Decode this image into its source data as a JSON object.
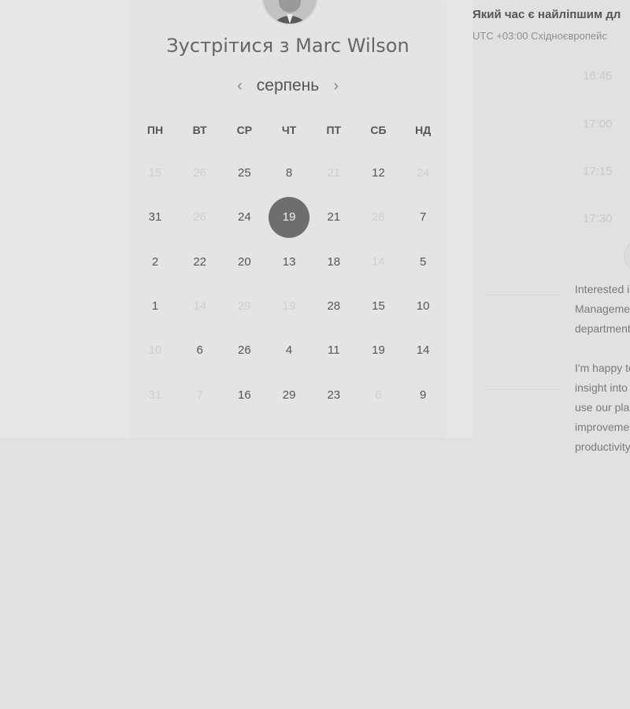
{
  "booking": {
    "title": "Зустрітися з Marc Wilson",
    "month": "серпень",
    "prev_icon": "‹",
    "next_icon": "›"
  },
  "weekdays": [
    "ПН",
    "ВТ",
    "СР",
    "ЧТ",
    "ПТ",
    "СБ",
    "НД"
  ],
  "days": [
    [
      {
        "n": "15",
        "d": true
      },
      {
        "n": "26",
        "d": true
      },
      {
        "n": "25",
        "d": false
      },
      {
        "n": "8",
        "d": false
      },
      {
        "n": "21",
        "d": true
      },
      {
        "n": "12",
        "d": false
      },
      {
        "n": "24",
        "d": true
      }
    ],
    [
      {
        "n": "31",
        "d": false
      },
      {
        "n": "26",
        "d": true
      },
      {
        "n": "24",
        "d": false
      },
      {
        "n": "19",
        "d": false,
        "sel": true
      },
      {
        "n": "21",
        "d": false
      },
      {
        "n": "28",
        "d": true
      },
      {
        "n": "7",
        "d": false
      }
    ],
    [
      {
        "n": "2",
        "d": false
      },
      {
        "n": "22",
        "d": false
      },
      {
        "n": "20",
        "d": false
      },
      {
        "n": "13",
        "d": false
      },
      {
        "n": "18",
        "d": false
      },
      {
        "n": "14",
        "d": true
      },
      {
        "n": "5",
        "d": false
      }
    ],
    [
      {
        "n": "1",
        "d": false
      },
      {
        "n": "14",
        "d": true
      },
      {
        "n": "29",
        "d": true
      },
      {
        "n": "19",
        "d": true
      },
      {
        "n": "28",
        "d": false
      },
      {
        "n": "15",
        "d": false
      },
      {
        "n": "10",
        "d": false
      }
    ],
    [
      {
        "n": "10",
        "d": true
      },
      {
        "n": "6",
        "d": false
      },
      {
        "n": "26",
        "d": false
      },
      {
        "n": "4",
        "d": false
      },
      {
        "n": "11",
        "d": false
      },
      {
        "n": "19",
        "d": false
      },
      {
        "n": "14",
        "d": false
      }
    ],
    [
      {
        "n": "31",
        "d": true
      },
      {
        "n": "7",
        "d": true
      },
      {
        "n": "16",
        "d": false
      },
      {
        "n": "29",
        "d": false
      },
      {
        "n": "23",
        "d": false
      },
      {
        "n": "6",
        "d": true
      },
      {
        "n": "9",
        "d": false
      }
    ]
  ],
  "schedule": {
    "question": "Який час є найліпшим дл",
    "timezone": "UTC +03:00 Східноєвропейс",
    "slots": [
      "16:45",
      "17:00",
      "17:15",
      "17:30"
    ]
  },
  "info": {
    "para1": [
      "Interested i",
      "Manageme",
      "department"
    ],
    "para2": [
      "I'm happy to",
      "insight into",
      "use our pla",
      "improveme",
      "productivity"
    ]
  }
}
